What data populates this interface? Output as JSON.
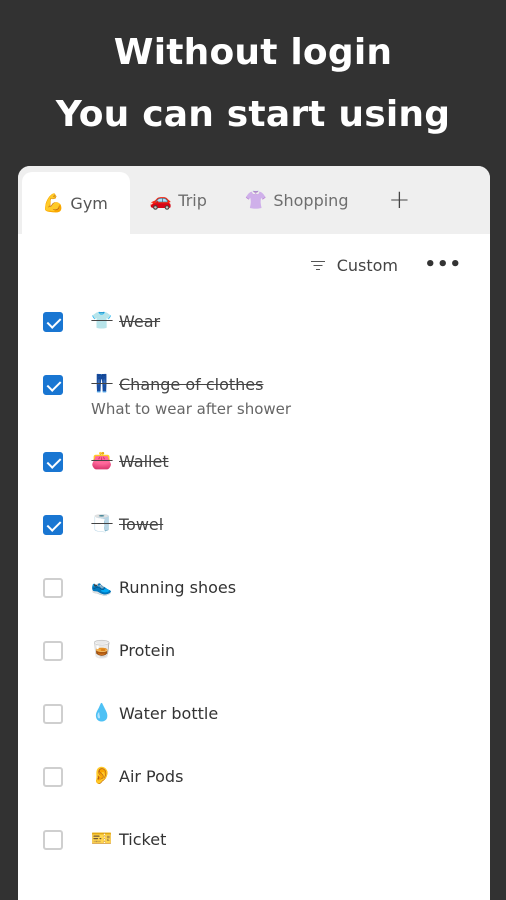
{
  "headline": {
    "line1": "Without login",
    "line2": "You can start using"
  },
  "tabs": [
    {
      "icon": "💪",
      "label": "Gym",
      "active": true
    },
    {
      "icon": "🚗",
      "label": "Trip",
      "active": false
    },
    {
      "icon": "👚",
      "label": "Shopping",
      "active": false
    }
  ],
  "add_tab_symbol": "+",
  "toolbar": {
    "sort_label": "Custom",
    "more_symbol": "•••"
  },
  "items": [
    {
      "icon": "👕",
      "label": "Wear",
      "checked": true
    },
    {
      "icon": "👖",
      "label": "Change of clothes",
      "note": "What to wear after shower",
      "checked": true
    },
    {
      "icon": "👛",
      "label": "Wallet",
      "checked": true
    },
    {
      "icon": "🧻",
      "label": "Towel",
      "checked": true
    },
    {
      "icon": "👟",
      "label": "Running shoes",
      "checked": false
    },
    {
      "icon": "🥃",
      "label": "Protein",
      "checked": false
    },
    {
      "icon": "💧",
      "label": "Water bottle",
      "checked": false
    },
    {
      "icon": "👂",
      "label": "Air Pods",
      "checked": false
    },
    {
      "icon": "🎫",
      "label": "Ticket",
      "checked": false
    }
  ],
  "colors": {
    "background": "#323232",
    "accent": "#1976d2",
    "tabbar": "#efefef"
  }
}
